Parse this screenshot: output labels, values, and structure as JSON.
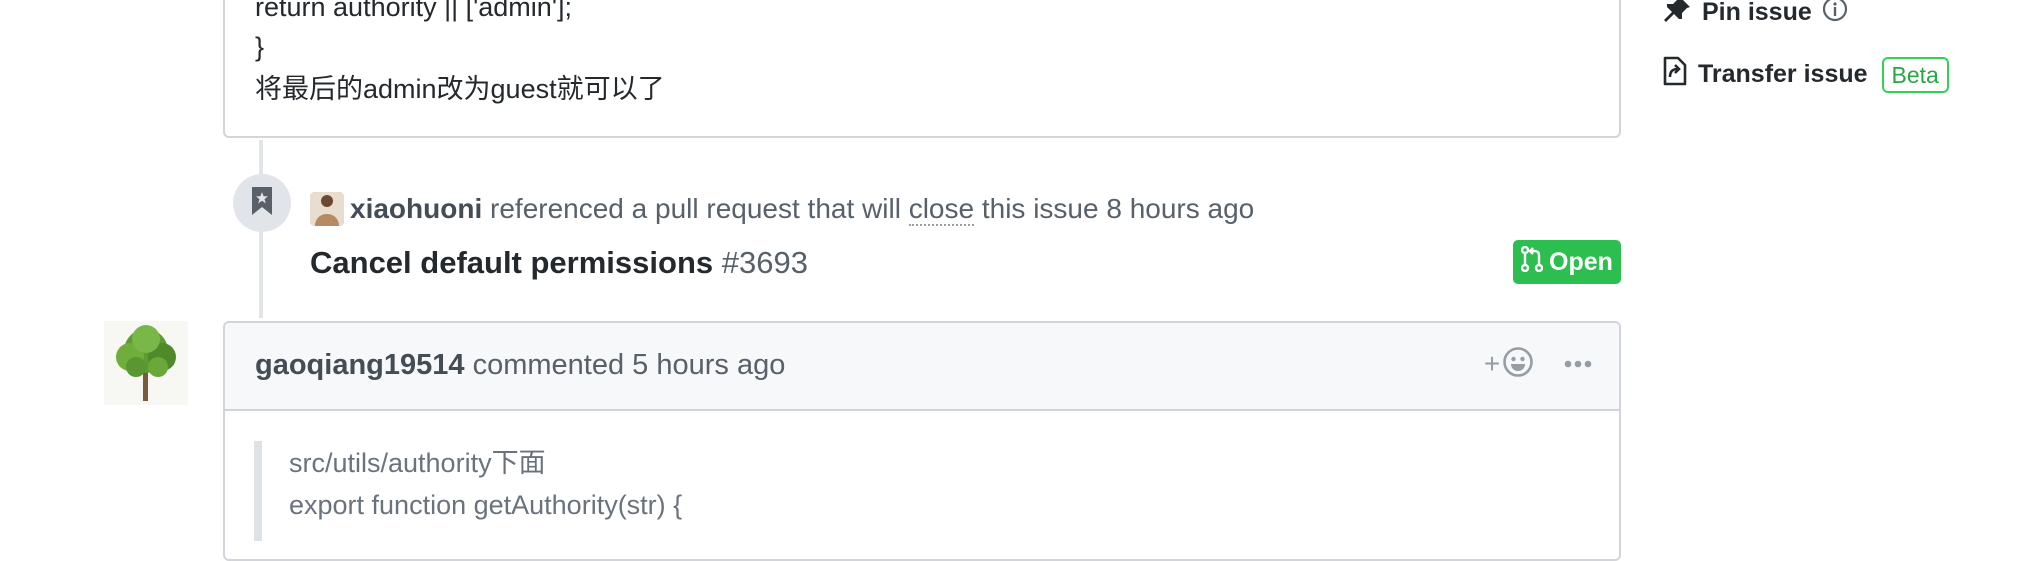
{
  "top_comment": {
    "lines": [
      "return authority || ['admin'];",
      "}",
      "将最后的admin改为guest就可以了"
    ]
  },
  "reference_event": {
    "author": "xiaohuoni",
    "text_before": "referenced a pull request that will",
    "close_word": "close",
    "text_after": "this issue 8 hours ago",
    "pr_title": "Cancel default permissions",
    "pr_number": "#3693",
    "pr_status": "Open"
  },
  "comment": {
    "author": "gaoqiang19514",
    "action": "commented",
    "time": "5 hours ago",
    "reaction_plus": "+",
    "quote_lines": [
      "src/utils/authority下面",
      "export function getAuthority(str) {"
    ]
  },
  "sidebar": {
    "pin_label": "Pin issue",
    "transfer_label": "Transfer issue",
    "beta_label": "Beta"
  },
  "colors": {
    "open_green": "#2cbe4e",
    "beta_green": "#28a745",
    "border": "#d1d5da"
  }
}
